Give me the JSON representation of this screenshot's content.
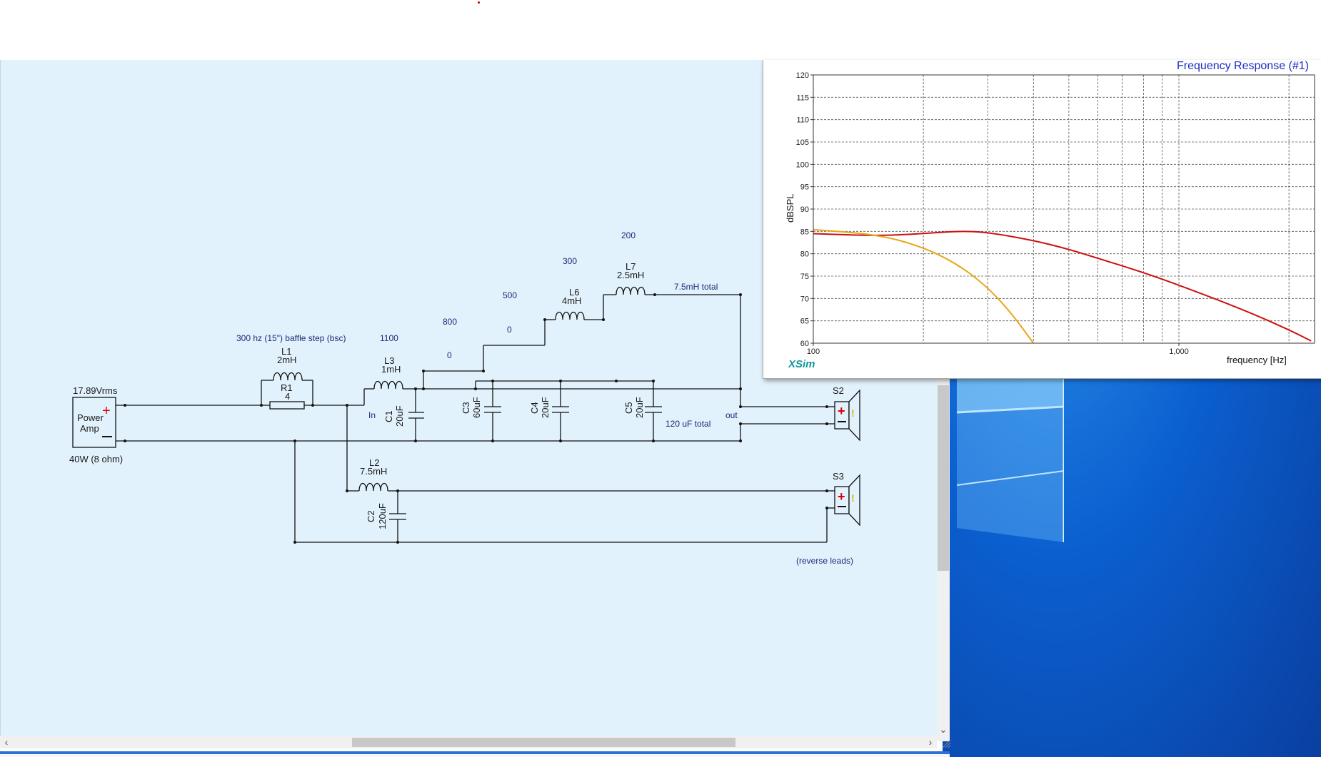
{
  "schematic": {
    "components": {
      "power_amp": {
        "voltage": "17.89Vrms",
        "label_line1": "Power",
        "label_line2": "Amp",
        "rating": "40W (8 ohm)"
      },
      "L1": {
        "name": "L1",
        "value": "2mH"
      },
      "R1": {
        "name": "R1",
        "value": "4"
      },
      "L3": {
        "name": "L3",
        "value": "1mH"
      },
      "C1": {
        "name": "C1",
        "value": "20uF"
      },
      "C3": {
        "name": "C3",
        "value": "60uF"
      },
      "C4": {
        "name": "C4",
        "value": "20uF"
      },
      "C5": {
        "name": "C5",
        "value": "20uF"
      },
      "L6": {
        "name": "L6",
        "value": "4mH"
      },
      "L7": {
        "name": "L7",
        "value": "2.5mH"
      },
      "L2": {
        "name": "L2",
        "value": "7.5mH"
      },
      "C2": {
        "name": "C2",
        "value": "120uF"
      },
      "S2": {
        "name": "S2"
      },
      "S3": {
        "name": "S3"
      }
    },
    "annotations": {
      "baffle_step": "300 hz (15\") baffle step (bsc)",
      "n1100": "1100",
      "n800": "800",
      "n500": "500",
      "n300": "300",
      "n200": "200",
      "zero_a": "0",
      "zero_b": "0",
      "total_l": "7.5mH total",
      "total_c": "120 uF total",
      "in_label": "In",
      "out_label": "out",
      "reverse_leads": "(reverse leads)"
    }
  },
  "frequency_response": {
    "title": "Frequency Response (#1)",
    "logo": "XSim",
    "chart_data": {
      "type": "line",
      "xlabel": "frequency [Hz]",
      "ylabel": "dBSPL",
      "x_scale": "log",
      "xlim": [
        100,
        2350
      ],
      "ylim": [
        60,
        120
      ],
      "yticks": [
        60,
        65,
        70,
        75,
        80,
        85,
        90,
        95,
        100,
        105,
        110,
        115,
        120
      ],
      "xtick_labels": [
        "100",
        "1,000"
      ],
      "grid": true,
      "series": [
        {
          "color": "#cc1111",
          "x": [
            100,
            150,
            200,
            250,
            300,
            400,
            500,
            600,
            800,
            1000,
            1500,
            2000,
            2300
          ],
          "y": [
            84.5,
            84.0,
            84.5,
            85.1,
            84.8,
            83.0,
            81.0,
            79.0,
            75.8,
            73.0,
            67.5,
            63.0,
            60.5
          ]
        },
        {
          "color": "#e6a817",
          "x": [
            100,
            150,
            200,
            250,
            300,
            350,
            400
          ],
          "y": [
            85.4,
            84.3,
            81.5,
            77.5,
            72.5,
            66.5,
            60.0
          ]
        }
      ]
    }
  },
  "colors": {
    "schematic_bg": "#e2f2fc",
    "plus_red": "#d90000",
    "annotation_blue": "#1b2a78",
    "title_blue": "#1c2dbd",
    "logo_teal": "#11979f"
  }
}
